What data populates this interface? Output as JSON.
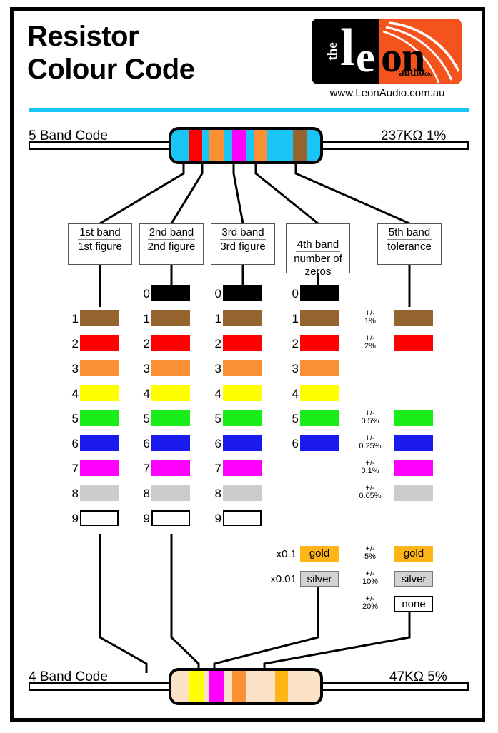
{
  "header": {
    "title_line1": "Resistor",
    "title_line2": "Colour Code",
    "logo": {
      "the": "the",
      "l": "l",
      "e": "e",
      "on": "on",
      "audio": "audio",
      "co": "co.",
      "url": "www.LeonAudio.com.au"
    },
    "accent_color": "#19c5f5"
  },
  "five_band": {
    "label": "5 Band Code",
    "value": "237KΩ  1%",
    "body_color": "#19c5f5",
    "bands": [
      {
        "name": "red",
        "color": "#ff0000"
      },
      {
        "name": "orange",
        "color": "#fb9034"
      },
      {
        "name": "magenta",
        "color": "#ff00ff"
      },
      {
        "name": "orange",
        "color": "#fb9034"
      },
      {
        "name": "brown",
        "color": "#96642f"
      }
    ]
  },
  "four_band": {
    "label": "4 Band Code",
    "value": "47KΩ  5%",
    "body_color": "#fce3c8",
    "bands": [
      {
        "name": "yellow",
        "color": "#ffff00"
      },
      {
        "name": "magenta",
        "color": "#ff00ff"
      },
      {
        "name": "orange",
        "color": "#fb9034"
      },
      {
        "name": "gold",
        "color": "#ffb515"
      }
    ]
  },
  "columns": [
    {
      "id": "band1",
      "title": "1st band",
      "subtitle": "1st figure"
    },
    {
      "id": "band2",
      "title": "2nd band",
      "subtitle": "2nd figure"
    },
    {
      "id": "band3",
      "title": "3rd band",
      "subtitle": "3rd figure"
    },
    {
      "id": "band4",
      "title": "4th band",
      "subtitle": "number of\nzeros"
    },
    {
      "id": "band5",
      "title": "5th band",
      "subtitle": "tolerance"
    }
  ],
  "colour_rows": [
    {
      "digit": "0",
      "name": "black",
      "color": "#000000",
      "outline": false
    },
    {
      "digit": "1",
      "name": "brown",
      "color": "#96642f",
      "outline": false
    },
    {
      "digit": "2",
      "name": "red",
      "color": "#ff0000",
      "outline": false
    },
    {
      "digit": "3",
      "name": "orange",
      "color": "#fb9034",
      "outline": false
    },
    {
      "digit": "4",
      "name": "yellow",
      "color": "#ffff00",
      "outline": false
    },
    {
      "digit": "5",
      "name": "green",
      "color": "#1aee1a",
      "outline": false
    },
    {
      "digit": "6",
      "name": "blue",
      "color": "#1a1aee",
      "outline": false
    },
    {
      "digit": "7",
      "name": "violet",
      "color": "#ff00ff",
      "outline": false
    },
    {
      "digit": "8",
      "name": "grey",
      "color": "#cccccc",
      "outline": false
    },
    {
      "digit": "9",
      "name": "white",
      "color": "#ffffff",
      "outline": true
    }
  ],
  "band1_digits": [
    "1",
    "2",
    "3",
    "4",
    "5",
    "6",
    "7",
    "8",
    "9"
  ],
  "band2_digits": [
    "0",
    "1",
    "2",
    "3",
    "4",
    "5",
    "6",
    "7",
    "8",
    "9"
  ],
  "band3_digits": [
    "0",
    "1",
    "2",
    "3",
    "4",
    "5",
    "6",
    "7",
    "8",
    "9"
  ],
  "band4_digits": [
    "0",
    "1",
    "2",
    "3",
    "4",
    "5",
    "6"
  ],
  "tolerances": [
    {
      "row": 1,
      "label_top": "+/-",
      "label_bot": "1%",
      "colour": "brown"
    },
    {
      "row": 2,
      "label_top": "+/-",
      "label_bot": "2%",
      "colour": "red"
    },
    {
      "row": 5,
      "label_top": "+/-",
      "label_bot": "0.5%",
      "colour": "green"
    },
    {
      "row": 6,
      "label_top": "+/-",
      "label_bot": "0.25%",
      "colour": "blue"
    },
    {
      "row": 7,
      "label_top": "+/-",
      "label_bot": "0.1%",
      "colour": "violet"
    },
    {
      "row": 8,
      "label_top": "+/-",
      "label_bot": "0.05%",
      "colour": "grey"
    }
  ],
  "multipliers": [
    {
      "label": "x0.1",
      "chip": "gold",
      "style": "gold"
    },
    {
      "label": "x0.01",
      "chip": "silver",
      "style": "silver"
    }
  ],
  "tolerance_chips": [
    {
      "label_top": "+/-",
      "label_bot": "5%",
      "chip": "gold",
      "style": "gold"
    },
    {
      "label_top": "+/-",
      "label_bot": "10%",
      "chip": "silver",
      "style": "silver"
    },
    {
      "label_top": "+/-",
      "label_bot": "20%",
      "chip": "none",
      "style": "none"
    }
  ]
}
